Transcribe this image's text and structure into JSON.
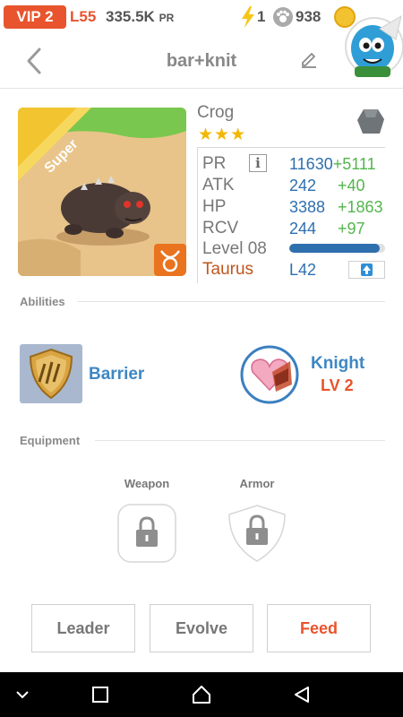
{
  "status": {
    "vip": "VIP 2",
    "level": "L55",
    "pr_value": "335.5K",
    "pr_suffix": "PR",
    "energy": "1",
    "paws": "938"
  },
  "header": {
    "title": "bar+knit"
  },
  "creature": {
    "name": "Crog",
    "stars": "★★★",
    "rarity_banner": "Super",
    "stats": [
      {
        "label": "PR",
        "value": "11630",
        "bonus": "+5111"
      },
      {
        "label": "ATK",
        "value": "242",
        "bonus": "+40"
      },
      {
        "label": "HP",
        "value": "3388",
        "bonus": "+1863"
      },
      {
        "label": "RCV",
        "value": "244",
        "bonus": "+97"
      }
    ],
    "level_label": "Level 08",
    "xp_progress": 0.94,
    "zodiac": "Taurus",
    "zodiac_level": "L42",
    "info_glyph": "i"
  },
  "abilities": {
    "title": "Abilities",
    "items": [
      {
        "name": "Barrier",
        "icon": "shield-claw-icon"
      },
      {
        "name": "Knight",
        "level": "LV 2",
        "icon": "heart-knight-icon"
      }
    ]
  },
  "equipment": {
    "title": "Equipment",
    "slots": [
      {
        "label": "Weapon",
        "icon": "lock-icon"
      },
      {
        "label": "Armor",
        "icon": "lock-icon"
      }
    ]
  },
  "actions": {
    "leader": "Leader",
    "evolve": "Evolve",
    "feed": "Feed"
  },
  "colors": {
    "accent_orange": "#e8542d",
    "link_blue": "#3e87c4",
    "stat_blue": "#2e6fae",
    "bonus_green": "#52b64c",
    "star_gold": "#f2b705"
  }
}
